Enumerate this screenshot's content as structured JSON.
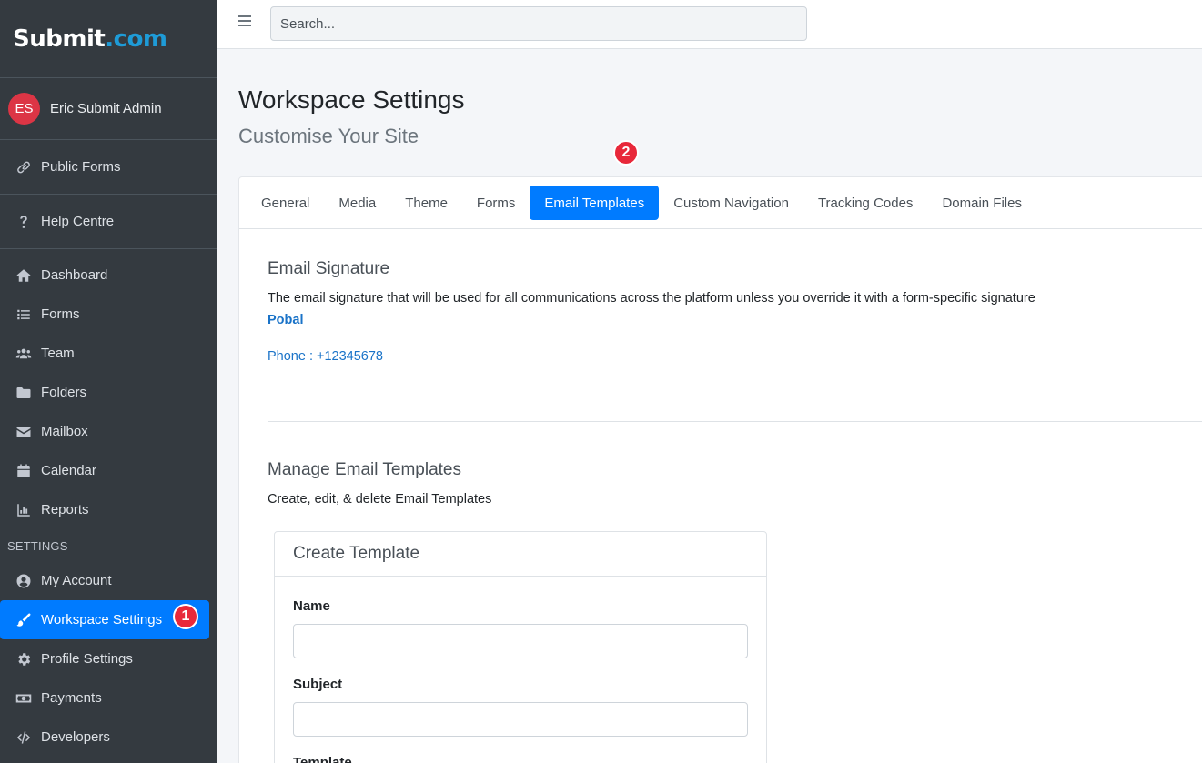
{
  "brand": {
    "part1": "Submit",
    "part2": ".com"
  },
  "user": {
    "initials": "ES",
    "name": "Eric Submit Admin"
  },
  "sidebar": {
    "top_links": [
      {
        "label": "Public Forms",
        "icon": "link-icon"
      },
      {
        "label": "Help Centre",
        "icon": "question-icon"
      }
    ],
    "main_items": [
      {
        "label": "Dashboard",
        "icon": "home-icon"
      },
      {
        "label": "Forms",
        "icon": "list-icon"
      },
      {
        "label": "Team",
        "icon": "users-icon"
      },
      {
        "label": "Folders",
        "icon": "folder-icon"
      },
      {
        "label": "Mailbox",
        "icon": "envelope-icon"
      },
      {
        "label": "Calendar",
        "icon": "calendar-icon"
      },
      {
        "label": "Reports",
        "icon": "chart-icon"
      }
    ],
    "settings_header": "SETTINGS",
    "settings_items": [
      {
        "label": "My Account",
        "icon": "user-circle-icon"
      },
      {
        "label": "Workspace Settings",
        "icon": "paintbrush-icon",
        "active": true
      },
      {
        "label": "Profile Settings",
        "icon": "gear-icon"
      },
      {
        "label": "Payments",
        "icon": "money-icon"
      },
      {
        "label": "Developers",
        "icon": "code-icon"
      }
    ]
  },
  "annotations": {
    "badge1": "1",
    "badge2": "2"
  },
  "search": {
    "placeholder": "Search..."
  },
  "page": {
    "title": "Workspace Settings",
    "subtitle": "Customise Your Site"
  },
  "tabs": [
    {
      "label": "General"
    },
    {
      "label": "Media"
    },
    {
      "label": "Theme"
    },
    {
      "label": "Forms"
    },
    {
      "label": "Email Templates",
      "active": true
    },
    {
      "label": "Custom Navigation"
    },
    {
      "label": "Tracking Codes"
    },
    {
      "label": "Domain Files"
    }
  ],
  "signature": {
    "title": "Email Signature",
    "description": "The email signature that will be used for all communications across the platform unless you override it with a form-specific signature",
    "name": "Pobal",
    "phone": "Phone : +12345678"
  },
  "templates": {
    "title": "Manage Email Templates",
    "description": "Create, edit, & delete Email Templates",
    "create_card_title": "Create Template",
    "name_label": "Name",
    "name_value": "",
    "subject_label": "Subject",
    "subject_value": "",
    "template_label": "Template"
  },
  "colors": {
    "accent": "#007bff",
    "sidebar_bg": "#343a40",
    "badge": "#e8283a",
    "brand_blue": "#1e9bd7"
  }
}
